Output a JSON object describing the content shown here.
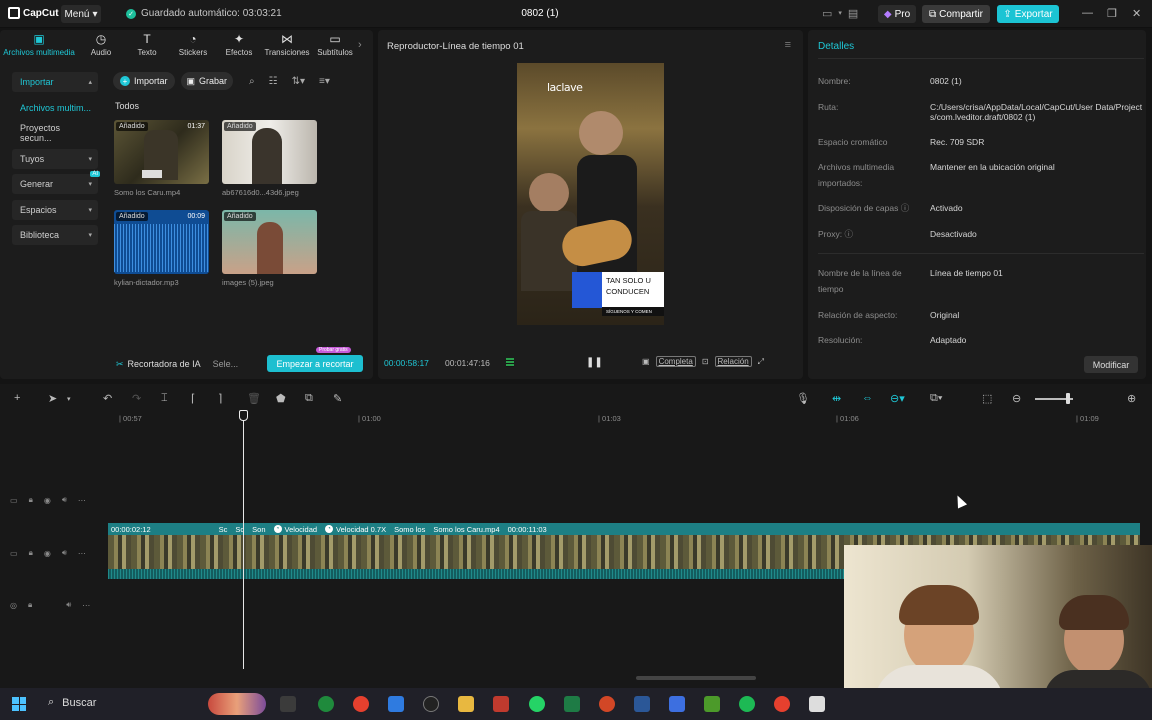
{
  "titlebar": {
    "app_name": "CapCut",
    "menu_label": "Menú",
    "autosave_text": "Guardado automático: 03:03:21",
    "project_title": "0802 (1)",
    "pro_label": "Pro",
    "share_label": "Compartir",
    "export_label": "Exportar"
  },
  "tool_tabs": [
    {
      "label": "Archivos multimedia",
      "icon": "media-icon"
    },
    {
      "label": "Audio",
      "icon": "audio-icon"
    },
    {
      "label": "Texto",
      "icon": "text-icon"
    },
    {
      "label": "Stickers",
      "icon": "sticker-icon"
    },
    {
      "label": "Efectos",
      "icon": "effects-icon"
    },
    {
      "label": "Transiciones",
      "icon": "transitions-icon"
    },
    {
      "label": "Subtítulos",
      "icon": "subtitles-icon"
    }
  ],
  "side_nav": [
    {
      "label": "Importar"
    },
    {
      "label": "Archivos multim..."
    },
    {
      "label": "Proyectos secun..."
    },
    {
      "label": "Tuyos"
    },
    {
      "label": "Generar",
      "badge": "AI"
    },
    {
      "label": "Espacios"
    },
    {
      "label": "Biblioteca"
    }
  ],
  "media": {
    "import_label": "Importar",
    "record_label": "Grabar",
    "all_label": "Todos",
    "items": [
      {
        "tag": "Añadido",
        "duration": "01:37",
        "name": "Somo los Caru.mp4"
      },
      {
        "tag": "Añadido",
        "duration": "",
        "name": "ab67616d0...43d6.jpeg"
      },
      {
        "tag": "Añadido",
        "duration": "00:09",
        "name": "kylian-dictador.mp3"
      },
      {
        "tag": "Añadido",
        "duration": "",
        "name": "images (5).jpeg"
      }
    ],
    "ai_label_prefix": "Recortadora de IA",
    "select_label": "Sele...",
    "start_crop_label": "Empezar a recortar",
    "free_badge": "Probar gratis"
  },
  "player": {
    "title": "Reproductor-Línea de tiempo 01",
    "watermark": "laclave",
    "caption_lines": [
      "TAN SOLO U",
      "CONDUCEN"
    ],
    "caption_footer": "SÍGUENOS Y COMEN",
    "current_time": "00:00:58:17",
    "total_time": "00:01:47:16",
    "complete_label": "Completa",
    "ratio_label": "Relación"
  },
  "details": {
    "title": "Detalles",
    "rows": [
      {
        "label": "Nombre:",
        "value": "0802 (1)"
      },
      {
        "label": "Ruta:",
        "value": "C:/Users/crisa/AppData/Local/CapCut/User Data/Projects/com.lveditor.draft/0802 (1)"
      },
      {
        "label": "Espacio cromático",
        "value": "Rec. 709 SDR"
      },
      {
        "label": "Archivos multimedia importados:",
        "value": "Mantener en la ubicación original"
      },
      {
        "label": "Disposición de capas",
        "value": "Activado"
      },
      {
        "label": "Proxy:",
        "value": "Desactivado"
      },
      {
        "label": "Nombre de la línea de tiempo",
        "value": "Línea de tiempo 01"
      },
      {
        "label": "Relación de aspecto:",
        "value": "Original"
      },
      {
        "label": "Resolución:",
        "value": "Adaptado"
      }
    ],
    "modify_label": "Modificar"
  },
  "timeline": {
    "ruler_ticks": [
      "| 00:57",
      "| 01:00",
      "| 01:03",
      "| 01:06",
      "| 01:09"
    ],
    "clip_start": "00:00:02:12",
    "clip_segments": [
      "Sc",
      "Sc",
      "Son"
    ],
    "speed_1": "Velocidad",
    "speed_2": "Velocidad 0.7X",
    "clip_name_short": "Somo los",
    "clip_name": "Somo los Caru.mp4",
    "clip_duration": "00:00:11:03"
  },
  "taskbar": {
    "search_label": "Buscar"
  },
  "colors": {
    "accent": "#1fc7d6",
    "clip": "#1d7f84",
    "background": "#141414"
  }
}
